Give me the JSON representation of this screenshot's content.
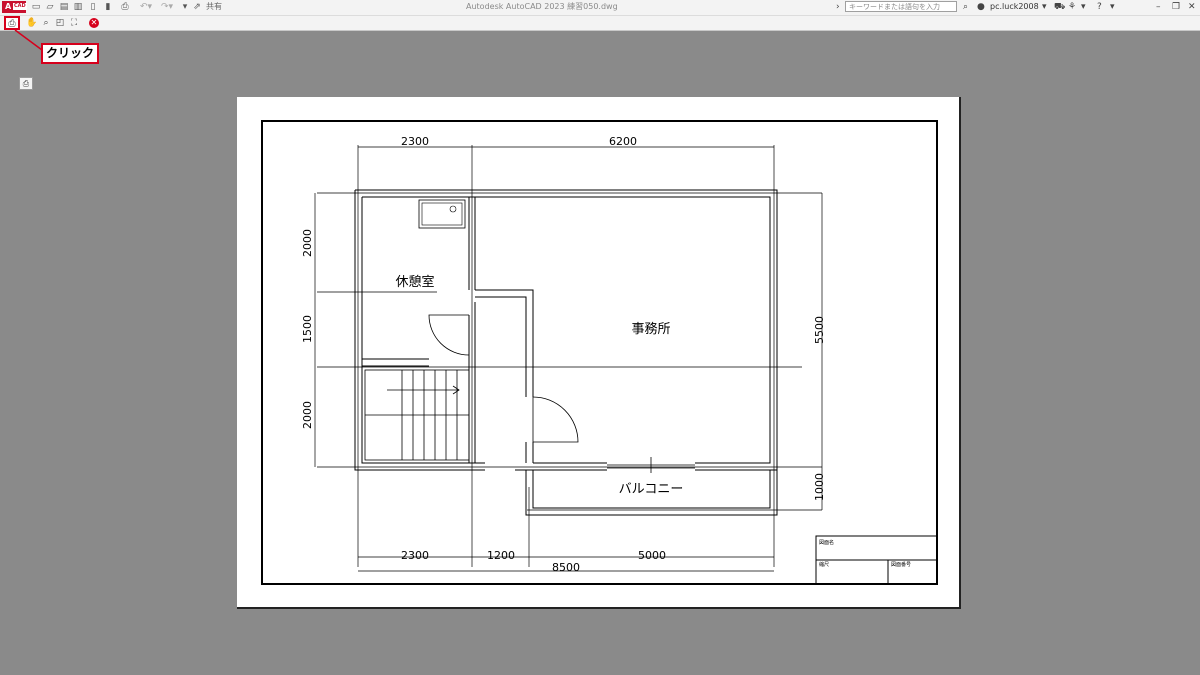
{
  "app": {
    "logo_letter": "A",
    "logo_sub": "CAD",
    "window_title": "Autodesk AutoCAD 2023   練習050.dwg",
    "share_label": "共有",
    "search_placeholder": "キーワードまたは語句を入力",
    "username": "pc.luck2008"
  },
  "callout": {
    "label": "クリック"
  },
  "drawing": {
    "rooms": {
      "rest_room": "休憩室",
      "office": "事務所",
      "balcony": "バルコニー"
    },
    "dims_top": [
      "2300",
      "6200"
    ],
    "dims_bottom": [
      "2300",
      "1200",
      "5000"
    ],
    "dim_total": "8500",
    "dims_left": [
      "2000",
      "1500",
      "2000"
    ],
    "dims_right": [
      "5500",
      "1000"
    ],
    "title_block": {
      "drawing_name": "図面名",
      "scale": "縮尺",
      "drawing_number": "図面番号"
    }
  },
  "colors": {
    "accent_red": "#d6001c",
    "canvas_gray": "#8a8a8a"
  }
}
